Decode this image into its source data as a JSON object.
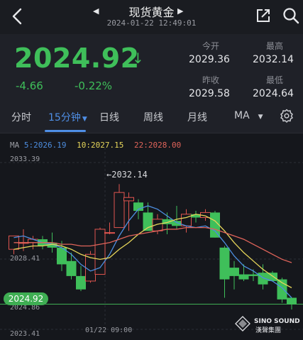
{
  "header": {
    "title": "现货黄金",
    "datetime": "2024-01-22 12:49:01"
  },
  "quote": {
    "price": "2024.92",
    "change": "-4.66",
    "change_pct": "-0.22%",
    "stats": {
      "open_label": "今开",
      "open": "2029.36",
      "high_label": "最高",
      "high": "2032.14",
      "prev_close_label": "昨收",
      "prev_close": "2029.58",
      "low_label": "最低",
      "low": "2024.64"
    }
  },
  "tabs": [
    {
      "label": "分时"
    },
    {
      "label": "15分钟"
    },
    {
      "label": "日线"
    },
    {
      "label": "周线"
    },
    {
      "label": "月线"
    },
    {
      "label": "MA"
    }
  ],
  "ma_legend": {
    "ma_label": "MA",
    "ma5": "5:2026.19",
    "ma10": "10:2027.15",
    "ma22": "22:2028.00"
  },
  "axis": {
    "y_top": "2033.39",
    "y_mid": "2028.41",
    "y_cur": "2024.86",
    "y_bottom": "2023.41",
    "x_time": "01/22 09:00",
    "high_marker": "←2032.14",
    "current_badge": "2024.92"
  },
  "watermark": {
    "en": "SINO SOUND",
    "cn": "漢聲集團"
  },
  "colors": {
    "up": "#3fbf5a",
    "down": "#e0554f",
    "accent": "#4f8fe6"
  },
  "chart_data": {
    "type": "candlestick",
    "ylim": [
      2023.41,
      2033.39
    ],
    "candles": [
      {
        "o": 2028.2,
        "h": 2029.0,
        "l": 2027.9,
        "c": 2029.0
      },
      {
        "o": 2028.6,
        "h": 2029.4,
        "l": 2028.1,
        "c": 2028.6
      },
      {
        "o": 2028.6,
        "h": 2029.0,
        "l": 2028.2,
        "c": 2028.8
      },
      {
        "o": 2028.8,
        "h": 2029.0,
        "l": 2028.2,
        "c": 2028.4
      },
      {
        "o": 2028.6,
        "h": 2029.2,
        "l": 2028.0,
        "c": 2028.3
      },
      {
        "o": 2028.3,
        "h": 2028.7,
        "l": 2026.9,
        "c": 2027.3
      },
      {
        "o": 2027.5,
        "h": 2028.0,
        "l": 2026.4,
        "c": 2026.6
      },
      {
        "o": 2026.6,
        "h": 2027.2,
        "l": 2025.7,
        "c": 2025.8
      },
      {
        "o": 2026.3,
        "h": 2028.1,
        "l": 2026.2,
        "c": 2027.9
      },
      {
        "o": 2026.7,
        "h": 2029.5,
        "l": 2026.7,
        "c": 2029.4
      },
      {
        "o": 2029.2,
        "h": 2029.8,
        "l": 2029.1,
        "c": 2029.2
      },
      {
        "o": 2029.5,
        "h": 2032.1,
        "l": 2029.5,
        "c": 2031.6
      },
      {
        "o": 2031.1,
        "h": 2031.6,
        "l": 2029.3,
        "c": 2031.3
      },
      {
        "o": 2031.0,
        "h": 2031.2,
        "l": 2030.0,
        "c": 2030.5
      },
      {
        "o": 2030.4,
        "h": 2031.0,
        "l": 2029.3,
        "c": 2029.3
      },
      {
        "o": 2029.3,
        "h": 2030.3,
        "l": 2029.1,
        "c": 2030.0
      },
      {
        "o": 2030.0,
        "h": 2030.4,
        "l": 2029.1,
        "c": 2029.7
      },
      {
        "o": 2029.9,
        "h": 2030.8,
        "l": 2029.4,
        "c": 2029.6
      },
      {
        "o": 2029.6,
        "h": 2030.6,
        "l": 2029.2,
        "c": 2030.3
      },
      {
        "o": 2030.3,
        "h": 2030.5,
        "l": 2029.8,
        "c": 2030.1
      },
      {
        "o": 2030.1,
        "h": 2030.6,
        "l": 2029.9,
        "c": 2030.4
      },
      {
        "o": 2030.4,
        "h": 2030.5,
        "l": 2028.9,
        "c": 2028.9
      },
      {
        "o": 2028.3,
        "h": 2028.4,
        "l": 2025.3,
        "c": 2026.4
      },
      {
        "o": 2027.1,
        "h": 2027.5,
        "l": 2025.8,
        "c": 2026.6
      },
      {
        "o": 2026.7,
        "h": 2027.3,
        "l": 2026.3,
        "c": 2026.4
      },
      {
        "o": 2026.7,
        "h": 2027.0,
        "l": 2026.3,
        "c": 2026.6
      },
      {
        "o": 2026.8,
        "h": 2027.3,
        "l": 2025.8,
        "c": 2026.1
      },
      {
        "o": 2026.8,
        "h": 2026.9,
        "l": 2026.3,
        "c": 2026.3
      },
      {
        "o": 2026.4,
        "h": 2026.5,
        "l": 2025.0,
        "c": 2025.2
      },
      {
        "o": 2025.3,
        "h": 2025.3,
        "l": 2024.6,
        "c": 2024.9
      }
    ],
    "ma5": [
      2028.9,
      2029.0,
      2028.8,
      2028.6,
      2028.5,
      2028.3,
      2027.9,
      2027.3,
      2026.9,
      2027.1,
      2027.9,
      2029.0,
      2029.9,
      2030.6,
      2030.8,
      2030.6,
      2030.2,
      2029.8,
      2029.6,
      2029.5,
      2029.6,
      2029.3,
      2028.6,
      2027.8,
      2027.2,
      2026.9,
      2026.5,
      2026.3,
      2025.9,
      2025.3
    ],
    "ma10": [
      2028.2,
      2028.3,
      2028.4,
      2028.4,
      2028.5,
      2028.4,
      2028.2,
      2027.9,
      2027.7,
      2027.6,
      2027.7,
      2028.2,
      2028.6,
      2029.1,
      2029.5,
      2029.7,
      2029.8,
      2030.0,
      2030.1,
      2030.3,
      2030.2,
      2029.9,
      2029.3,
      2028.6,
      2028.0,
      2027.5,
      2027.0,
      2026.6,
      2026.2,
      2025.9
    ],
    "ma22": [
      2028.6,
      2028.6,
      2028.6,
      2028.6,
      2028.6,
      2028.5,
      2028.5,
      2028.4,
      2028.4,
      2028.5,
      2028.6,
      2028.8,
      2029.0,
      2029.1,
      2029.2,
      2029.3,
      2029.4,
      2029.4,
      2029.5,
      2029.5,
      2029.5,
      2029.4,
      2029.2,
      2029.0,
      2028.8,
      2028.5,
      2028.2,
      2027.9,
      2027.6,
      2027.4
    ]
  }
}
